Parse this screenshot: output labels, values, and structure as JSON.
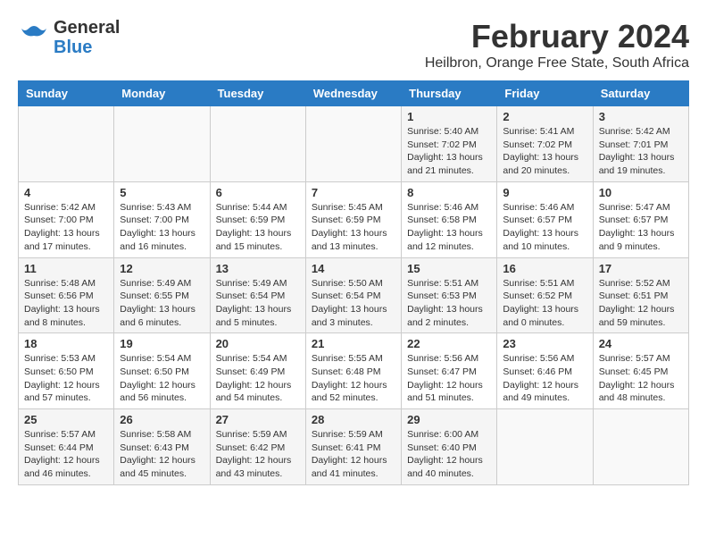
{
  "header": {
    "logo_general": "General",
    "logo_blue": "Blue",
    "month_title": "February 2024",
    "location": "Heilbron, Orange Free State, South Africa"
  },
  "days_of_week": [
    "Sunday",
    "Monday",
    "Tuesday",
    "Wednesday",
    "Thursday",
    "Friday",
    "Saturday"
  ],
  "weeks": [
    [
      {
        "day": "",
        "info": ""
      },
      {
        "day": "",
        "info": ""
      },
      {
        "day": "",
        "info": ""
      },
      {
        "day": "",
        "info": ""
      },
      {
        "day": "1",
        "info": "Sunrise: 5:40 AM\nSunset: 7:02 PM\nDaylight: 13 hours\nand 21 minutes."
      },
      {
        "day": "2",
        "info": "Sunrise: 5:41 AM\nSunset: 7:02 PM\nDaylight: 13 hours\nand 20 minutes."
      },
      {
        "day": "3",
        "info": "Sunrise: 5:42 AM\nSunset: 7:01 PM\nDaylight: 13 hours\nand 19 minutes."
      }
    ],
    [
      {
        "day": "4",
        "info": "Sunrise: 5:42 AM\nSunset: 7:00 PM\nDaylight: 13 hours\nand 17 minutes."
      },
      {
        "day": "5",
        "info": "Sunrise: 5:43 AM\nSunset: 7:00 PM\nDaylight: 13 hours\nand 16 minutes."
      },
      {
        "day": "6",
        "info": "Sunrise: 5:44 AM\nSunset: 6:59 PM\nDaylight: 13 hours\nand 15 minutes."
      },
      {
        "day": "7",
        "info": "Sunrise: 5:45 AM\nSunset: 6:59 PM\nDaylight: 13 hours\nand 13 minutes."
      },
      {
        "day": "8",
        "info": "Sunrise: 5:46 AM\nSunset: 6:58 PM\nDaylight: 13 hours\nand 12 minutes."
      },
      {
        "day": "9",
        "info": "Sunrise: 5:46 AM\nSunset: 6:57 PM\nDaylight: 13 hours\nand 10 minutes."
      },
      {
        "day": "10",
        "info": "Sunrise: 5:47 AM\nSunset: 6:57 PM\nDaylight: 13 hours\nand 9 minutes."
      }
    ],
    [
      {
        "day": "11",
        "info": "Sunrise: 5:48 AM\nSunset: 6:56 PM\nDaylight: 13 hours\nand 8 minutes."
      },
      {
        "day": "12",
        "info": "Sunrise: 5:49 AM\nSunset: 6:55 PM\nDaylight: 13 hours\nand 6 minutes."
      },
      {
        "day": "13",
        "info": "Sunrise: 5:49 AM\nSunset: 6:54 PM\nDaylight: 13 hours\nand 5 minutes."
      },
      {
        "day": "14",
        "info": "Sunrise: 5:50 AM\nSunset: 6:54 PM\nDaylight: 13 hours\nand 3 minutes."
      },
      {
        "day": "15",
        "info": "Sunrise: 5:51 AM\nSunset: 6:53 PM\nDaylight: 13 hours\nand 2 minutes."
      },
      {
        "day": "16",
        "info": "Sunrise: 5:51 AM\nSunset: 6:52 PM\nDaylight: 13 hours\nand 0 minutes."
      },
      {
        "day": "17",
        "info": "Sunrise: 5:52 AM\nSunset: 6:51 PM\nDaylight: 12 hours\nand 59 minutes."
      }
    ],
    [
      {
        "day": "18",
        "info": "Sunrise: 5:53 AM\nSunset: 6:50 PM\nDaylight: 12 hours\nand 57 minutes."
      },
      {
        "day": "19",
        "info": "Sunrise: 5:54 AM\nSunset: 6:50 PM\nDaylight: 12 hours\nand 56 minutes."
      },
      {
        "day": "20",
        "info": "Sunrise: 5:54 AM\nSunset: 6:49 PM\nDaylight: 12 hours\nand 54 minutes."
      },
      {
        "day": "21",
        "info": "Sunrise: 5:55 AM\nSunset: 6:48 PM\nDaylight: 12 hours\nand 52 minutes."
      },
      {
        "day": "22",
        "info": "Sunrise: 5:56 AM\nSunset: 6:47 PM\nDaylight: 12 hours\nand 51 minutes."
      },
      {
        "day": "23",
        "info": "Sunrise: 5:56 AM\nSunset: 6:46 PM\nDaylight: 12 hours\nand 49 minutes."
      },
      {
        "day": "24",
        "info": "Sunrise: 5:57 AM\nSunset: 6:45 PM\nDaylight: 12 hours\nand 48 minutes."
      }
    ],
    [
      {
        "day": "25",
        "info": "Sunrise: 5:57 AM\nSunset: 6:44 PM\nDaylight: 12 hours\nand 46 minutes."
      },
      {
        "day": "26",
        "info": "Sunrise: 5:58 AM\nSunset: 6:43 PM\nDaylight: 12 hours\nand 45 minutes."
      },
      {
        "day": "27",
        "info": "Sunrise: 5:59 AM\nSunset: 6:42 PM\nDaylight: 12 hours\nand 43 minutes."
      },
      {
        "day": "28",
        "info": "Sunrise: 5:59 AM\nSunset: 6:41 PM\nDaylight: 12 hours\nand 41 minutes."
      },
      {
        "day": "29",
        "info": "Sunrise: 6:00 AM\nSunset: 6:40 PM\nDaylight: 12 hours\nand 40 minutes."
      },
      {
        "day": "",
        "info": ""
      },
      {
        "day": "",
        "info": ""
      }
    ]
  ]
}
